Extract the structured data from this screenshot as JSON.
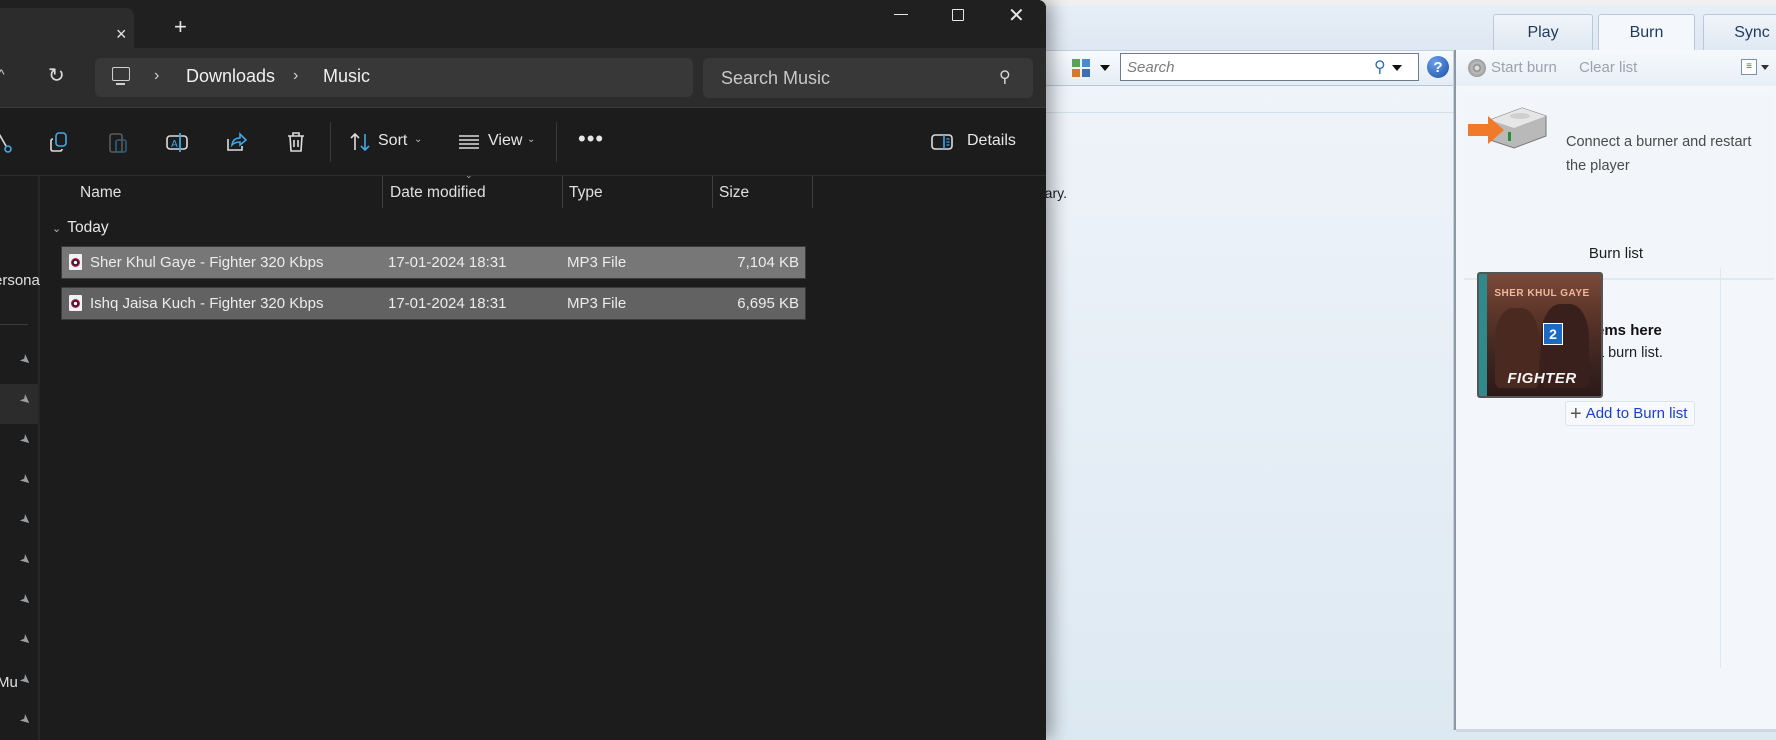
{
  "explorer": {
    "tab": {
      "close_icon": "×",
      "new_tab_icon": "+"
    },
    "window_controls": {
      "minimize": "minimize",
      "maximize": "maximize",
      "close": "✕"
    },
    "address": {
      "breadcrumb": [
        "Downloads",
        "Music"
      ],
      "separator": "›",
      "refresh_icon": "↻",
      "up_icon": "^",
      "search_placeholder": "Search Music",
      "search_icon": "⌕"
    },
    "commandbar": {
      "sort_label": "Sort",
      "view_label": "View",
      "more_label": "•••",
      "details_label": "Details",
      "chevron": "⌄"
    },
    "navpane": {
      "partial_item_1": "ersona",
      "partial_item_2": "Mu",
      "pin_icon": "📌"
    },
    "columns": [
      "Name",
      "Date modified",
      "Type",
      "Size"
    ],
    "group_label": "Today",
    "group_chevron": "⌄",
    "files": [
      {
        "name": "Sher Khul Gaye - Fighter 320 Kbps",
        "date": "17-01-2024 18:31",
        "type": "MP3 File",
        "size": "7,104 KB"
      },
      {
        "name": "Ishq Jaisa Kuch - Fighter 320 Kbps",
        "date": "17-01-2024 18:31",
        "type": "MP3 File",
        "size": "6,695 KB"
      }
    ]
  },
  "wmp": {
    "tabs": [
      "Play",
      "Burn",
      "Sync"
    ],
    "active_tab": "Burn",
    "search_placeholder": "Search",
    "help_icon": "?",
    "library_text_partial": "rary.",
    "burn": {
      "start_burn": "Start burn",
      "clear_list": "Clear list",
      "device_message": "Connect a burner and restart the player",
      "burn_list_title": "Burn list",
      "drag_hint_bold": "ems here",
      "drag_hint": "a burn list.",
      "drag_count": "2",
      "album_title_top": "SHER KHUL GAYE",
      "album_title_bottom": "FIGHTER",
      "add_button": "Add to Burn list",
      "add_icon": "+"
    }
  }
}
